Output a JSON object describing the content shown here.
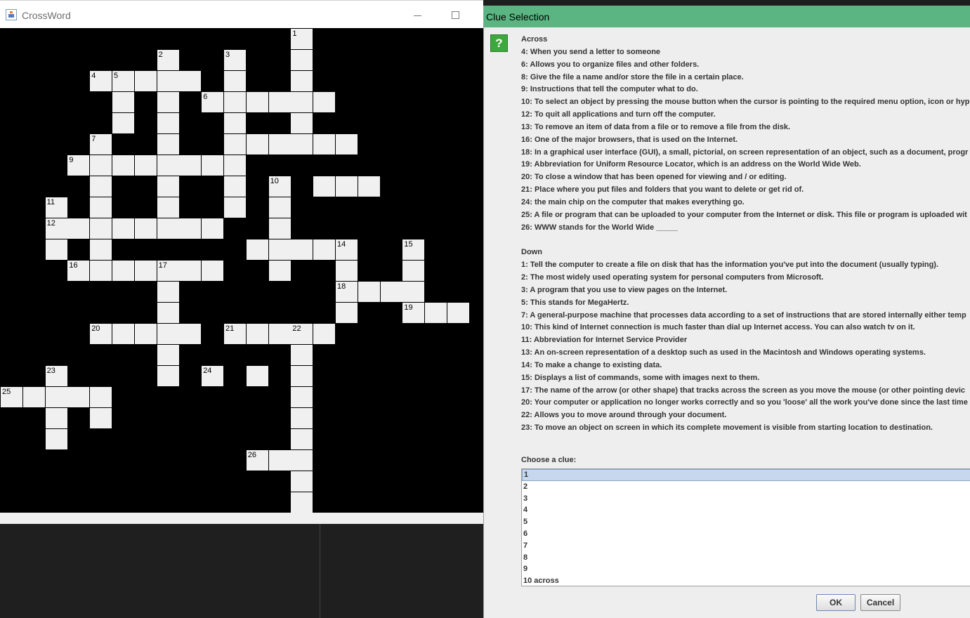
{
  "main_window": {
    "title": "CrossWord",
    "icon": "java-cup-icon"
  },
  "crossword": {
    "cell_color": "#f0f0f0",
    "background_color": "#000000",
    "cells": [
      [
        13,
        0,
        "1"
      ],
      [
        13,
        1,
        ""
      ],
      [
        13,
        2,
        ""
      ],
      [
        13,
        3,
        ""
      ],
      [
        13,
        4,
        ""
      ],
      [
        7,
        1,
        "2"
      ],
      [
        7,
        2,
        ""
      ],
      [
        7,
        3,
        ""
      ],
      [
        7,
        4,
        ""
      ],
      [
        7,
        5,
        ""
      ],
      [
        7,
        6,
        ""
      ],
      [
        7,
        7,
        ""
      ],
      [
        7,
        8,
        ""
      ],
      [
        7,
        9,
        ""
      ],
      [
        10,
        1,
        "3"
      ],
      [
        10,
        2,
        ""
      ],
      [
        10,
        3,
        ""
      ],
      [
        10,
        4,
        ""
      ],
      [
        10,
        5,
        ""
      ],
      [
        10,
        6,
        ""
      ],
      [
        10,
        7,
        ""
      ],
      [
        10,
        8,
        ""
      ],
      [
        4,
        2,
        "4"
      ],
      [
        5,
        2,
        "5"
      ],
      [
        6,
        2,
        ""
      ],
      [
        8,
        2,
        ""
      ],
      [
        5,
        3,
        ""
      ],
      [
        5,
        4,
        ""
      ],
      [
        9,
        3,
        "6"
      ],
      [
        11,
        3,
        ""
      ],
      [
        12,
        3,
        ""
      ],
      [
        14,
        3,
        ""
      ],
      [
        4,
        5,
        "7"
      ],
      [
        4,
        6,
        ""
      ],
      [
        4,
        7,
        ""
      ],
      [
        4,
        8,
        ""
      ],
      [
        4,
        9,
        ""
      ],
      [
        4,
        10,
        ""
      ],
      [
        4,
        11,
        ""
      ],
      [
        11,
        5,
        ""
      ],
      [
        12,
        5,
        ""
      ],
      [
        13,
        5,
        ""
      ],
      [
        14,
        5,
        ""
      ],
      [
        15,
        5,
        ""
      ],
      [
        3,
        6,
        "9"
      ],
      [
        5,
        6,
        ""
      ],
      [
        6,
        6,
        ""
      ],
      [
        8,
        6,
        ""
      ],
      [
        9,
        6,
        ""
      ],
      [
        12,
        7,
        "10"
      ],
      [
        14,
        7,
        ""
      ],
      [
        15,
        7,
        ""
      ],
      [
        16,
        7,
        ""
      ],
      [
        2,
        8,
        "11"
      ],
      [
        12,
        8,
        ""
      ],
      [
        2,
        9,
        "12"
      ],
      [
        3,
        9,
        ""
      ],
      [
        5,
        9,
        ""
      ],
      [
        6,
        9,
        ""
      ],
      [
        8,
        9,
        ""
      ],
      [
        9,
        9,
        ""
      ],
      [
        12,
        9,
        ""
      ],
      [
        2,
        10,
        ""
      ],
      [
        11,
        10,
        ""
      ],
      [
        12,
        10,
        ""
      ],
      [
        13,
        10,
        ""
      ],
      [
        14,
        10,
        ""
      ],
      [
        15,
        10,
        "14"
      ],
      [
        18,
        10,
        "15"
      ],
      [
        3,
        11,
        "16"
      ],
      [
        5,
        11,
        ""
      ],
      [
        6,
        11,
        ""
      ],
      [
        7,
        11,
        "17"
      ],
      [
        8,
        11,
        ""
      ],
      [
        9,
        11,
        ""
      ],
      [
        12,
        11,
        ""
      ],
      [
        15,
        11,
        ""
      ],
      [
        18,
        11,
        ""
      ],
      [
        7,
        12,
        ""
      ],
      [
        15,
        12,
        "18"
      ],
      [
        16,
        12,
        ""
      ],
      [
        17,
        12,
        ""
      ],
      [
        18,
        12,
        ""
      ],
      [
        7,
        13,
        ""
      ],
      [
        15,
        13,
        ""
      ],
      [
        18,
        13,
        "19"
      ],
      [
        19,
        13,
        ""
      ],
      [
        20,
        13,
        ""
      ],
      [
        4,
        14,
        "20"
      ],
      [
        5,
        14,
        ""
      ],
      [
        6,
        14,
        ""
      ],
      [
        7,
        14,
        ""
      ],
      [
        8,
        14,
        ""
      ],
      [
        10,
        14,
        "21"
      ],
      [
        11,
        14,
        ""
      ],
      [
        12,
        14,
        ""
      ],
      [
        13,
        14,
        "22"
      ],
      [
        14,
        14,
        ""
      ],
      [
        7,
        15,
        ""
      ],
      [
        13,
        15,
        ""
      ],
      [
        2,
        16,
        "23"
      ],
      [
        7,
        16,
        ""
      ],
      [
        9,
        16,
        "24"
      ],
      [
        11,
        16,
        ""
      ],
      [
        13,
        16,
        ""
      ],
      [
        0,
        17,
        "25"
      ],
      [
        1,
        17,
        ""
      ],
      [
        2,
        17,
        ""
      ],
      [
        3,
        17,
        ""
      ],
      [
        4,
        17,
        ""
      ],
      [
        13,
        17,
        ""
      ],
      [
        2,
        18,
        ""
      ],
      [
        4,
        18,
        ""
      ],
      [
        13,
        18,
        ""
      ],
      [
        2,
        19,
        ""
      ],
      [
        13,
        19,
        ""
      ],
      [
        11,
        20,
        "26"
      ],
      [
        12,
        20,
        ""
      ],
      [
        13,
        20,
        ""
      ],
      [
        13,
        21,
        ""
      ],
      [
        13,
        22,
        ""
      ]
    ]
  },
  "dialog": {
    "title": "Clue Selection",
    "icon": "question-icon",
    "icon_glyph": "?",
    "clue_lines": [
      "Across",
      "4: When you send a letter to someone",
      "6: Allows you to organize files and other folders.",
      "8: Give the file a name and/or store the file in a certain place.",
      "9: Instructions that tell the computer what to do.",
      "10: To select an object by pressing the mouse button when the cursor is pointing to the required menu option, icon or hyp",
      "12: To quit all applications and turn off the computer.",
      "13: To remove an item of data from a file or to remove a file from the disk.",
      "16: One of the major browsers, that is used on the Internet.",
      "18: In a graphical user interface (GUI), a small, pictorial, on screen representation of an object, such as a document, progr",
      "19: Abbreviation for Uniform Resource Locator, which is an address on the World Wide Web.",
      "20: To close a window that has been opened for viewing and / or editing.",
      "21: Place where you put files and folders that you want to delete or get rid of.",
      "24: the main chip on the computer that makes everything go.",
      "25: A file or program that can be uploaded to your computer from the Internet or disk. This file or program is uploaded wit",
      "26: WWW stands for the World Wide _____",
      "",
      "Down",
      "1: Tell the computer to create a file on disk that has the information you've put into the document (usually typing).",
      "2: The most widely used operating system for personal computers from Microsoft.",
      "3: A program that you use to view pages on the Internet.",
      "5: This stands for MegaHertz.",
      "7: A general-purpose machine that processes data according to a set of instructions that are stored internally either temp",
      "10: This kind of Internet connection is much faster than dial up Internet access. You can also watch tv on it.",
      "11: Abbreviation for Internet Service Provider",
      "13: An on-screen representation of a desktop such as used in the Macintosh and Windows operating systems.",
      "14: To make a change to existing data.",
      "15: Displays a list of commands, some with images next to them.",
      "17: The name of the arrow (or other shape) that tracks across the screen as you move the mouse (or other pointing devic",
      "20: Your computer or application no longer works correctly and so you 'loose' all the work you've done since the last time",
      "22: Allows you to move around through your document.",
      "23: To move an object on screen in which its complete movement is visible from starting location to destination."
    ],
    "choose_label": "Choose a clue:",
    "list_items": [
      "1",
      "2",
      "3",
      "4",
      "5",
      "6",
      "7",
      "8",
      "9",
      "10 across"
    ],
    "selected_index": 0,
    "ok_label": "OK",
    "cancel_label": "Cancel"
  }
}
